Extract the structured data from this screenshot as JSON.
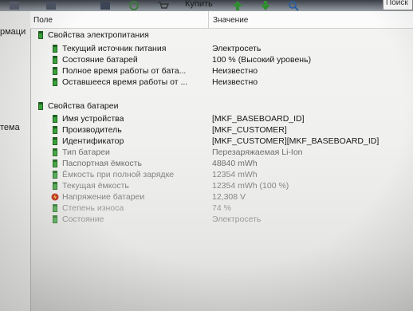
{
  "toolbar": {
    "buy_label": "Купить",
    "search_label": "Поиск"
  },
  "sidebar": {
    "items": [
      "рмаци",
      "тема"
    ]
  },
  "columns": {
    "field": "Поле",
    "value": "Значение"
  },
  "groups": [
    {
      "title": "Свойства электропитания",
      "rows": [
        {
          "field": "Текущий источник питания",
          "value": "Электросеть",
          "icon": "battery-icon"
        },
        {
          "field": "Состояние батарей",
          "value": "100 % (Высокий уровень)",
          "icon": "battery-icon"
        },
        {
          "field": "Полное время работы от бата...",
          "value": "Неизвестно",
          "icon": "battery-icon"
        },
        {
          "field": "Оставшееся время работы от ...",
          "value": "Неизвестно",
          "icon": "battery-icon"
        }
      ]
    },
    {
      "title": "Свойства батареи",
      "rows": [
        {
          "field": "Имя устройства",
          "value": "[MKF_BASEBOARD_ID]",
          "icon": "battery-icon"
        },
        {
          "field": "Производитель",
          "value": "[MKF_CUSTOMER]",
          "icon": "battery-icon"
        },
        {
          "field": "Идентификатор",
          "value": "[MKF_CUSTOMER][MKF_BASEBOARD_ID]",
          "icon": "battery-icon"
        },
        {
          "field": "Тип батареи",
          "value": "Перезаряжаемая Li-Ion",
          "icon": "battery-icon"
        },
        {
          "field": "Паспортная ёмкость",
          "value": "48840 mWh",
          "icon": "battery-icon"
        },
        {
          "field": "Ёмкость при полной зарядке",
          "value": "12354 mWh",
          "icon": "battery-icon"
        },
        {
          "field": "Текущая ёмкость",
          "value": "12354 mWh  (100 %)",
          "icon": "battery-icon"
        },
        {
          "field": "Напряжение батареи",
          "value": "12,308 V",
          "icon": "voltage-icon"
        },
        {
          "field": "Степень износа",
          "value": "74 %",
          "icon": "battery-icon"
        },
        {
          "field": "Состояние",
          "value": "Электросеть",
          "icon": "battery-icon"
        }
      ]
    }
  ],
  "colors": {
    "icon_green": "#2f8f2f",
    "icon_dark": "#1f5f1f",
    "voltage_red": "#c23b2b"
  }
}
